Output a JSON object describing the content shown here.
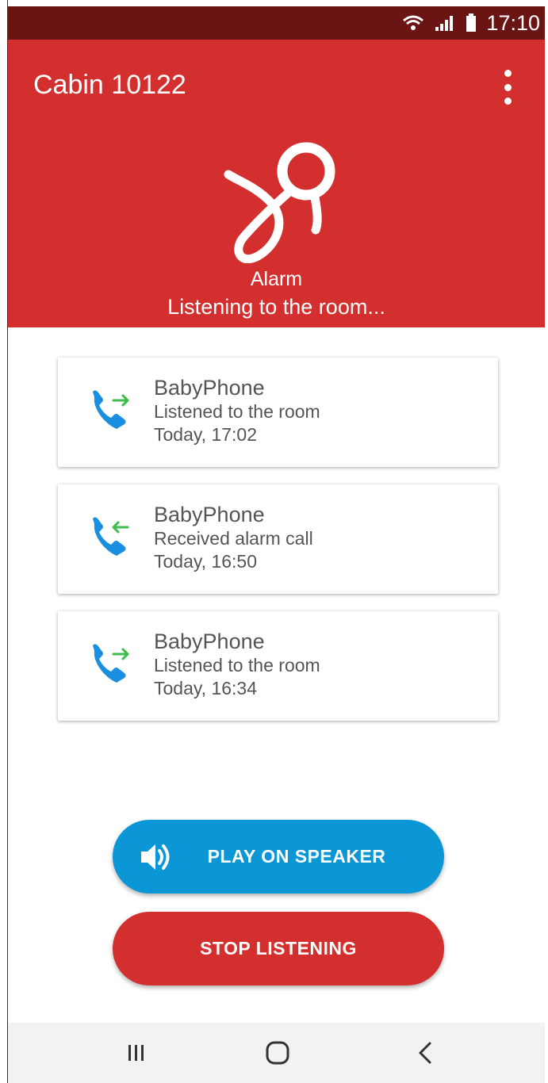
{
  "status_bar": {
    "time": "17:10"
  },
  "app_bar": {
    "title": "Cabin 10122",
    "menu_icon": "more-vert-icon"
  },
  "header": {
    "icon": "pacifier-icon",
    "label": "Alarm",
    "status": "Listening to the room..."
  },
  "calls": [
    {
      "icon": "outgoing-call-icon",
      "name": "BabyPhone",
      "description": "Listened to the room",
      "time": "Today, 17:02"
    },
    {
      "icon": "incoming-call-icon",
      "name": "BabyPhone",
      "description": "Received alarm call",
      "time": "Today, 16:50"
    },
    {
      "icon": "outgoing-call-icon",
      "name": "BabyPhone",
      "description": "Listened to the room",
      "time": "Today, 16:34"
    }
  ],
  "actions": {
    "speaker_label": "PLAY ON SPEAKER",
    "stop_label": "STOP LISTENING"
  },
  "colors": {
    "status_bar": "#6b1414",
    "primary": "#d32f2f",
    "speaker_button": "#0b96d6",
    "phone_icon": "#1a8fe0",
    "arrow": "#3dbd4a"
  }
}
